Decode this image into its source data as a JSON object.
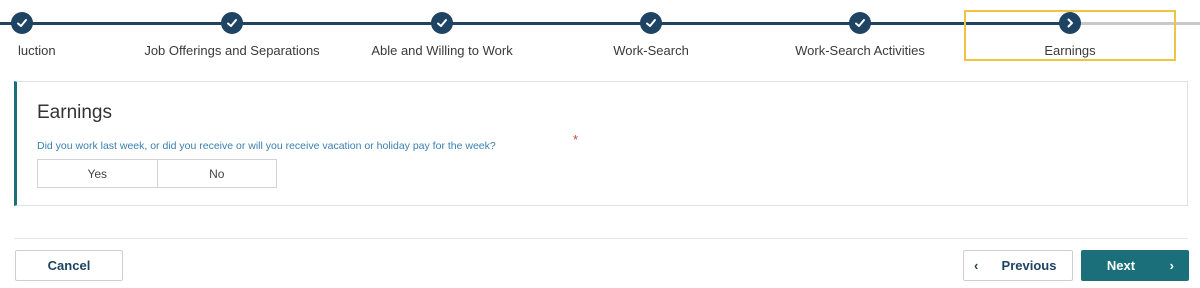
{
  "stepper": {
    "steps": [
      {
        "label": "luction",
        "state": "complete"
      },
      {
        "label": "Job Offerings and Separations",
        "state": "complete"
      },
      {
        "label": "Able and Willing to Work",
        "state": "complete"
      },
      {
        "label": "Work-Search",
        "state": "complete"
      },
      {
        "label": "Work-Search Activities",
        "state": "complete"
      },
      {
        "label": "Earnings",
        "state": "current"
      }
    ]
  },
  "card": {
    "title": "Earnings",
    "question": "Did you work last week, or did you receive or will you receive vacation or holiday pay for the week?",
    "required_mark": "*",
    "options": {
      "yes": "Yes",
      "no": "No"
    }
  },
  "footer": {
    "cancel_label": "Cancel",
    "previous_label": "Previous",
    "next_label": "Next",
    "previous_chevron": "‹",
    "next_chevron": "›"
  },
  "colors": {
    "primary": "#1e4363",
    "accent": "#1b6f7a",
    "highlight": "#efc443",
    "required": "#d0453a",
    "question_text": "#3b7fb0"
  }
}
